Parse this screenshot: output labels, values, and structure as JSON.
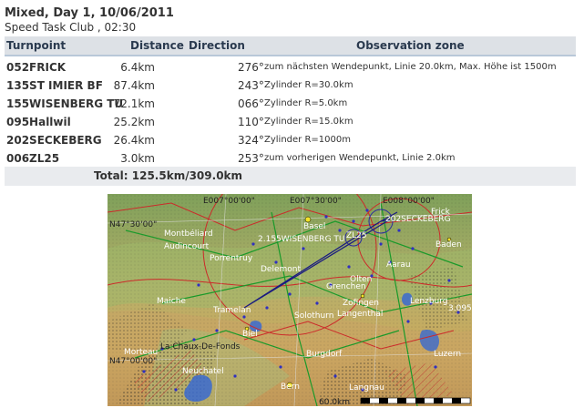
{
  "header": {
    "title": "Mixed, Day 1, 10/06/2011",
    "subtitle": "Speed Task Club , 02:30"
  },
  "table": {
    "columns": {
      "turnpoint": "Turnpoint",
      "distance": "Distance",
      "direction": "Direction",
      "observation": "Observation zone"
    },
    "rows": [
      {
        "turnpoint": "052FRICK",
        "distance": "6.4km",
        "direction": "276°",
        "observation": "zum nächsten Wendepunkt, Linie 20.0km, Max. Höhe ist 1500m"
      },
      {
        "turnpoint": "135ST IMIER BF",
        "distance": "87.4km",
        "direction": "243°",
        "observation": "Zylinder R=30.0km"
      },
      {
        "turnpoint": "155WISENBERG TU",
        "distance": "72.1km",
        "direction": "066°",
        "observation": "Zylinder R=5.0km"
      },
      {
        "turnpoint": "095Hallwil",
        "distance": "25.2km",
        "direction": "110°",
        "observation": "Zylinder R=15.0km"
      },
      {
        "turnpoint": "202SECKEBERG",
        "distance": "26.4km",
        "direction": "324°",
        "observation": "Zylinder R=1000m"
      },
      {
        "turnpoint": "006ZL25",
        "distance": "3.0km",
        "direction": "253°",
        "observation": "zum vorherigen Wendepunkt, Linie 2.0km"
      }
    ],
    "total": "Total: 125.5km/309.0km"
  },
  "map": {
    "labels": {
      "e7": "E007°00'00\"",
      "e730": "E007°30'00\"",
      "e8": "E008°00'00\"",
      "n4730": "N47°30'00\"",
      "n47": "N47°00'00\"",
      "seckeberg": "202SECKEBERG",
      "wisenberg": "2.155WISENBERG TU",
      "zl25": "ZL25",
      "frick": "Frick",
      "basel": "Basel",
      "montbeliard": "Montbéliard",
      "audincourt": "Audincourt",
      "porrentruy": "Porrentruy",
      "delemont": "Delemont",
      "baden": "Baden",
      "aarau": "Aarau",
      "olten": "Olten",
      "zofingen": "Zofingen",
      "langenthal": "Langenthal",
      "solothurn": "Solothurn",
      "grenchen": "Grenchen",
      "biel": "Biel",
      "tramelan": "Tramelan",
      "morteau": "Morteau",
      "lachaux": "La Chaux-De-Fonds",
      "neuchatel": "Neuchatel",
      "burgdorf": "Burgdorf",
      "bern": "Bern",
      "langnau": "Langnau",
      "luzern": "Luzern",
      "lenzburg": "Lenzburg",
      "scale": "60.0km",
      "marker": "3.095",
      "maiche": "Maiche"
    }
  }
}
